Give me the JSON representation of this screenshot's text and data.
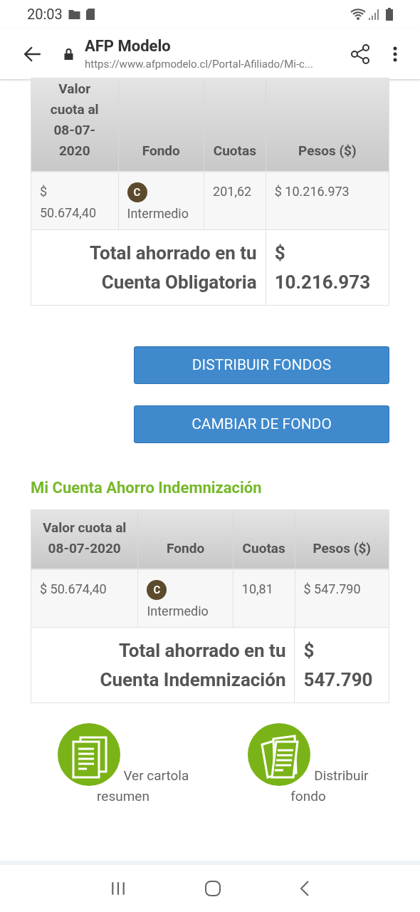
{
  "status_bar": {
    "time": "20:03"
  },
  "browser": {
    "title": "AFP Modelo",
    "url": "https://www.afpmodelo.cl/Portal-Afiliado/Mi-c..."
  },
  "accounts": [
    {
      "columns": [
        "Valor cuota al 08-07-2020",
        "Fondo",
        "Cuotas",
        "Pesos ($)"
      ],
      "row": {
        "valor": "$ 50.674,40",
        "fund_letter": "C",
        "fund_name": "Intermedio",
        "cuotas": "201,62",
        "pesos": "$ 10.216.973"
      },
      "total_label": "Total ahorrado en tu Cuenta Obligatoria",
      "total_value": "$ 10.216.973",
      "buttons": [
        "DISTRIBUIR FONDOS",
        "CAMBIAR DE FONDO"
      ]
    },
    {
      "title": "Mi Cuenta Ahorro Indemnización",
      "columns": [
        "Valor cuota al 08-07-2020",
        "Fondo",
        "Cuotas",
        "Pesos ($)"
      ],
      "row": {
        "valor": "$ 50.674,40",
        "fund_letter": "C",
        "fund_name": "Intermedio",
        "cuotas": "10,81",
        "pesos": "$ 547.790"
      },
      "total_label": "Total ahorrado en tu Cuenta Indemnización",
      "total_value": "$ 547.790"
    }
  ],
  "links": [
    {
      "kind": "stack",
      "label": "Ver cartola resumen"
    },
    {
      "kind": "fan",
      "label": "Distribuir fondo"
    }
  ]
}
